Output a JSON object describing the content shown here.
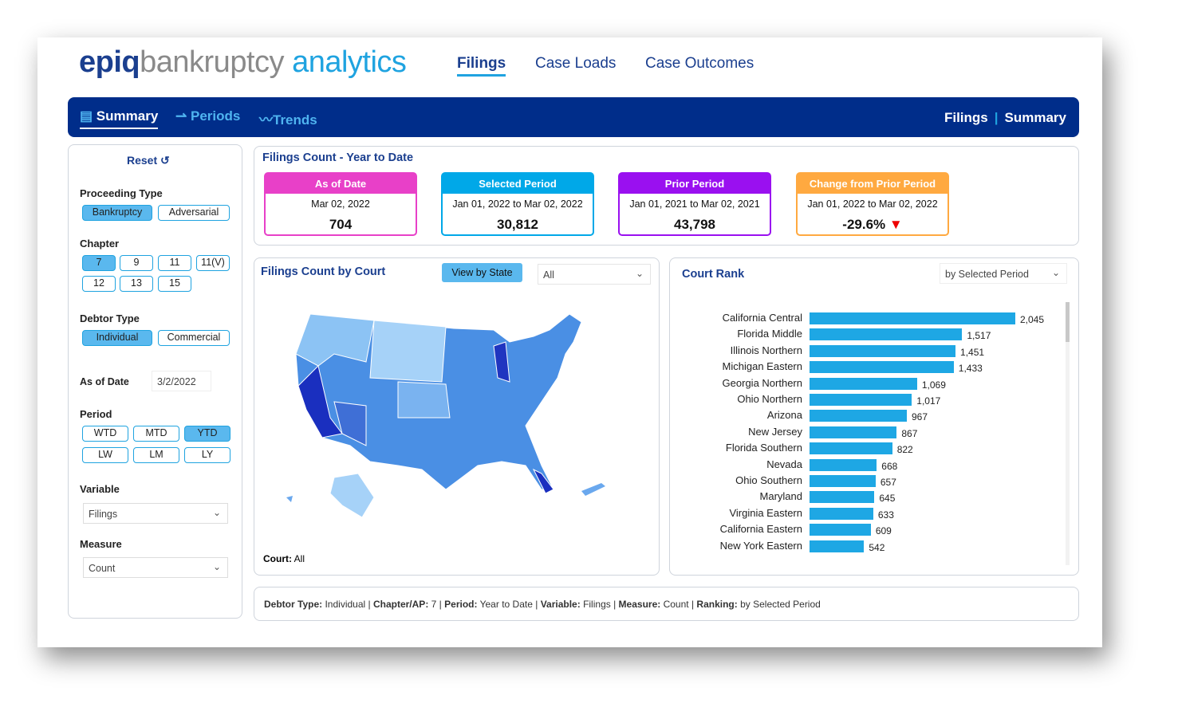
{
  "logo": {
    "part1": "epiq",
    "part2": "bankruptcy",
    "part3": "analytics"
  },
  "top_nav": [
    {
      "label": "Filings",
      "active": true
    },
    {
      "label": "Case Loads"
    },
    {
      "label": "Case Outcomes"
    }
  ],
  "sub_nav": {
    "tabs": [
      {
        "label": "Summary",
        "icon": "list-icon",
        "active": true
      },
      {
        "label": "Periods",
        "icon": "arrows-icon"
      },
      {
        "label": "Trends",
        "icon": "trend-icon"
      }
    ],
    "breadcrumb": [
      "Filings",
      "Summary"
    ],
    "separator": "|"
  },
  "filters": {
    "reset": "Reset",
    "reset_icon": "↺",
    "proceeding_type": {
      "label": "Proceeding Type",
      "options": [
        "Bankruptcy",
        "Adversarial"
      ],
      "selected": "Bankruptcy"
    },
    "chapter": {
      "label": "Chapter",
      "options": [
        "7",
        "9",
        "11",
        "11(V)",
        "12",
        "13",
        "15"
      ],
      "selected": "7"
    },
    "debtor_type": {
      "label": "Debtor Type",
      "options": [
        "Individual",
        "Commercial"
      ],
      "selected": "Individual"
    },
    "as_of_date": {
      "label": "As of Date",
      "value": "3/2/2022"
    },
    "period": {
      "label": "Period",
      "options": [
        "WTD",
        "MTD",
        "YTD",
        "LW",
        "LM",
        "LY"
      ],
      "selected": "YTD"
    },
    "variable": {
      "label": "Variable",
      "value": "Filings"
    },
    "measure": {
      "label": "Measure",
      "value": "Count"
    }
  },
  "kpis": {
    "title": "Filings Count - Year to Date",
    "cards": [
      {
        "header": "As of Date",
        "date": "Mar 02, 2022",
        "value": "704",
        "color": "#e840c8"
      },
      {
        "header": "Selected Period",
        "date": "Jan 01, 2022 to Mar 02, 2022",
        "value": "30,812",
        "color": "#00a8e8"
      },
      {
        "header": "Prior Period",
        "date": "Jan 01, 2021 to Mar 02, 2021",
        "value": "43,798",
        "color": "#9a10f0"
      },
      {
        "header": "Change from Prior Period",
        "date": "Jan 01, 2022 to Mar 02, 2022",
        "value": "-29.6%",
        "color": "#ffa940",
        "indicator": "▼"
      }
    ]
  },
  "map": {
    "title": "Filings Count by Court",
    "view_button": "View by State",
    "dropdown": "All",
    "footer_label": "Court:",
    "footer_value": "All"
  },
  "rank": {
    "title": "Court Rank",
    "dropdown": "by Selected Period",
    "items": [
      {
        "court": "California Central",
        "value": 2045,
        "label": "2,045"
      },
      {
        "court": "Florida Middle",
        "value": 1517,
        "label": "1,517"
      },
      {
        "court": "Illinois Northern",
        "value": 1451,
        "label": "1,451"
      },
      {
        "court": "Michigan Eastern",
        "value": 1433,
        "label": "1,433"
      },
      {
        "court": "Georgia Northern",
        "value": 1069,
        "label": "1,069"
      },
      {
        "court": "Ohio Northern",
        "value": 1017,
        "label": "1,017"
      },
      {
        "court": "Arizona",
        "value": 967,
        "label": "967"
      },
      {
        "court": "New Jersey",
        "value": 867,
        "label": "867"
      },
      {
        "court": "Florida Southern",
        "value": 822,
        "label": "822"
      },
      {
        "court": "Nevada",
        "value": 668,
        "label": "668"
      },
      {
        "court": "Ohio Southern",
        "value": 657,
        "label": "657"
      },
      {
        "court": "Maryland",
        "value": 645,
        "label": "645"
      },
      {
        "court": "Virginia Eastern",
        "value": 633,
        "label": "633"
      },
      {
        "court": "California Eastern",
        "value": 609,
        "label": "609"
      },
      {
        "court": "New York Eastern",
        "value": 542,
        "label": "542"
      }
    ]
  },
  "summary": [
    {
      "k": "Debtor Type:",
      "v": "Individual"
    },
    {
      "k": "Chapter/AP:",
      "v": "7"
    },
    {
      "k": "Period:",
      "v": "Year to Date"
    },
    {
      "k": "Variable:",
      "v": "Filings"
    },
    {
      "k": "Measure:",
      "v": "Count"
    },
    {
      "k": "Ranking:",
      "v": "by Selected Period"
    }
  ]
}
